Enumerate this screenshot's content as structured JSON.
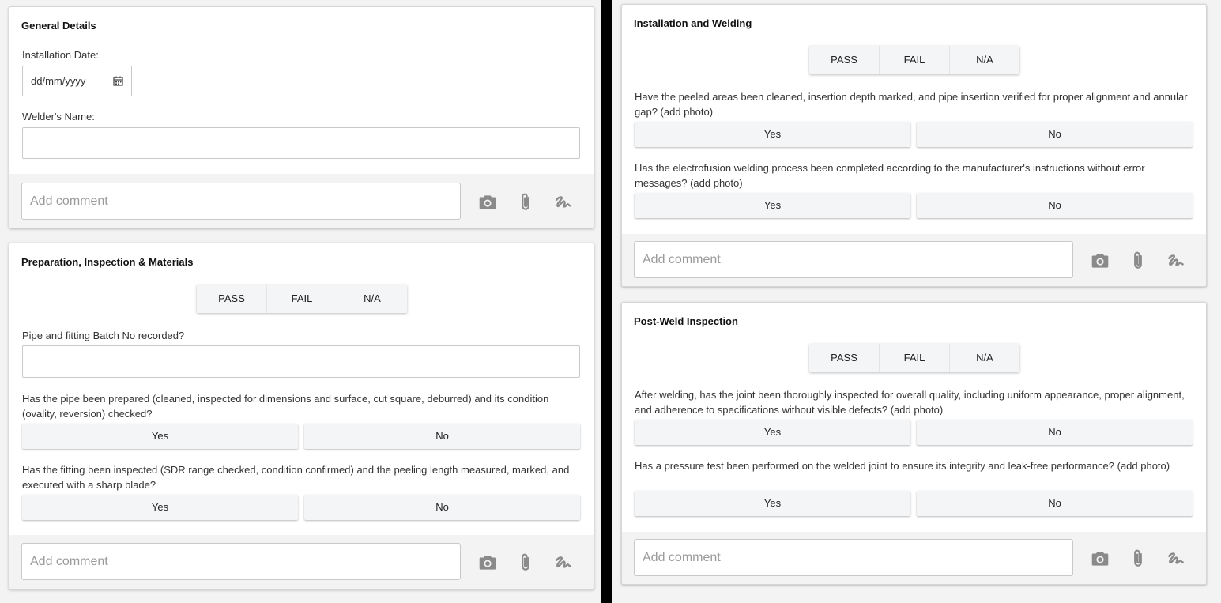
{
  "cards": {
    "general": {
      "title": "General Details",
      "installation_date_label": "Installation Date:",
      "installation_date_placeholder": "dd/mm/yyyy",
      "welder_name_label": "Welder's Name:",
      "welder_name_value": "",
      "comment_placeholder": "Add comment"
    },
    "prep": {
      "title": "Preparation, Inspection & Materials",
      "seg": {
        "pass": "PASS",
        "fail": "FAIL",
        "na": "N/A"
      },
      "batch_label": "Pipe and fitting Batch No recorded?",
      "batch_value": "",
      "q1": "Has the pipe been prepared (cleaned, inspected for dimensions and surface, cut square, deburred) and its condition (ovality, reversion) checked?",
      "q2": "Has the fitting been inspected (SDR range checked, condition confirmed) and the peeling length measured, marked, and executed with a sharp blade?",
      "yes": "Yes",
      "no": "No",
      "comment_placeholder": "Add comment"
    },
    "install": {
      "title": "Installation and Welding",
      "seg": {
        "pass": "PASS",
        "fail": "FAIL",
        "na": "N/A"
      },
      "q1": "Have the peeled areas been cleaned, insertion depth marked, and pipe insertion verified for proper alignment and annular gap? (add photo)",
      "q2": "Has the electrofusion welding process been completed according to the manufacturer's instructions without error messages? (add photo)",
      "yes": "Yes",
      "no": "No",
      "comment_placeholder": "Add comment"
    },
    "post": {
      "title": "Post-Weld Inspection",
      "seg": {
        "pass": "PASS",
        "fail": "FAIL",
        "na": "N/A"
      },
      "q1": "After welding, has the joint been thoroughly inspected for overall quality, including uniform appearance, proper alignment, and adherence to specifications without visible defects? (add photo)",
      "q2": "Has a pressure test been performed on the welded joint to ensure its integrity and leak-free performance? (add photo)",
      "yes": "Yes",
      "no": "No",
      "comment_placeholder": "Add comment"
    }
  },
  "icons": {
    "camera": "camera-icon",
    "attachment": "paperclip-icon",
    "signature": "signature-icon",
    "calendar": "calendar-icon"
  },
  "colors": {
    "background": "#f3f3f3",
    "divider": "#000000",
    "card": "#ffffff",
    "button": "#f4f5f6",
    "icon": "#8a8a8a",
    "placeholder": "#9a9a9a"
  }
}
